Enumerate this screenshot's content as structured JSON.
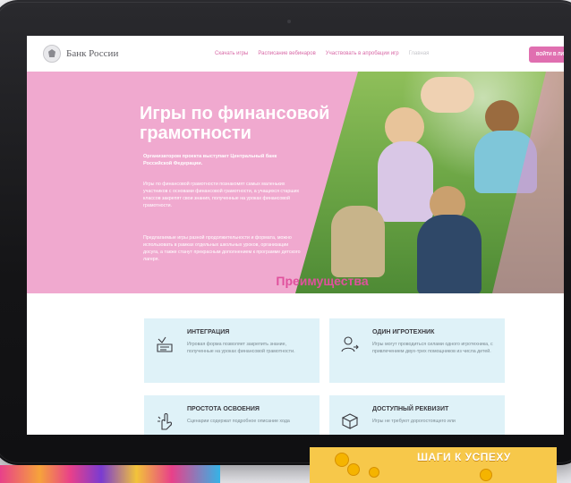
{
  "header": {
    "brand": "Банк России",
    "nav": [
      {
        "label": "Скачать игры"
      },
      {
        "label": "Расписание вебинаров"
      },
      {
        "label": "Участвовать в апробации игр"
      },
      {
        "label": "Главная"
      }
    ],
    "login_label": "ВОЙТИ В ЛИ"
  },
  "hero": {
    "title": "Игры по финансовой грамотности",
    "lead": "Организатором проекта выступает Центральный банк Российской Федерации.",
    "paragraph1": "Игры по финансовой грамотности познакомят самых маленьких участников с основами финансовой грамотности, а учащихся старших классов закрепят свои знания, полученные на уроках финансовой грамотности.",
    "paragraph2": "Предлагаемые игры разной продолжительности и формата, можно использовать в рамках отдельных школьных уроков, организации досуга, а также станут прекрасным дополнением к программе детского лагеря."
  },
  "advantages": {
    "title": "Преимущества",
    "cards": [
      {
        "title": "ИНТЕГРАЦИЯ",
        "text": "Игровая форма позволяет закрепить знание, полученные на уроках финансовой грамотности.",
        "icon": "chart-list-icon"
      },
      {
        "title": "ОДИН ИГРОТЕХНИК",
        "text": "Игры могут проводиться силами одного игротехника, с привлечением двух-трех помощников из числа детей.",
        "icon": "person-icon"
      },
      {
        "title": "ПРОСТОТА ОСВОЕНИЯ",
        "text": "Сценарии содержат подробное описание хода",
        "icon": "hand-pointer-icon"
      },
      {
        "title": "ДОСТУПНЫЙ РЕКВИЗИТ",
        "text": "Игры не требуют дорогостоящего или",
        "icon": "box-icon"
      }
    ]
  },
  "thumbnail_right": {
    "title": "ШАГИ К УСПЕХУ"
  }
}
